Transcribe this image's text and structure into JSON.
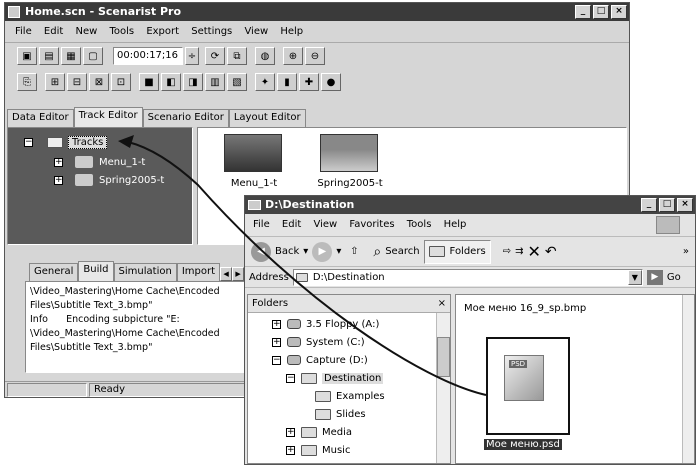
{
  "sp": {
    "title": "Home.scn - Scenarist Pro",
    "menu": [
      "File",
      "Edit",
      "New",
      "Tools",
      "Export",
      "Settings",
      "View",
      "Help"
    ],
    "timecode": "00:00:17;16",
    "tabs": [
      "Data Editor",
      "Track Editor",
      "Scenario Editor",
      "Layout Editor"
    ],
    "tree": {
      "root": "Tracks",
      "items": [
        "Menu_1-t",
        "Spring2005-t"
      ]
    },
    "thumbs": [
      "Menu_1-t",
      "Spring2005-t"
    ],
    "log_tabs": [
      "General",
      "Build",
      "Simulation",
      "Import"
    ],
    "log_lines": [
      "\\Video_Mastering\\Home Cache\\Encoded",
      "Files\\Subtitle Text_3.bmp\"",
      "Info      Encoding subpicture \"E:",
      "\\Video_Mastering\\Home Cache\\Encoded",
      "Files\\Subtitle Text_3.bmp\""
    ],
    "status": "Ready"
  },
  "ex": {
    "title": "D:\\Destination",
    "menu": [
      "File",
      "Edit",
      "View",
      "Favorites",
      "Tools",
      "Help"
    ],
    "back": "Back",
    "search": "Search",
    "folders": "Folders",
    "address_label": "Address",
    "address": "D:\\Destination",
    "go": "Go",
    "folders_title": "Folders",
    "tree": [
      {
        "label": "3.5 Floppy (A:)",
        "lvl": 1,
        "pm": "+",
        "icon": "drive"
      },
      {
        "label": "System (C:)",
        "lvl": 1,
        "pm": "+",
        "icon": "drive"
      },
      {
        "label": "Capture (D:)",
        "lvl": 1,
        "pm": "−",
        "icon": "drive"
      },
      {
        "label": "Destination",
        "lvl": 2,
        "pm": "−",
        "icon": "folder",
        "sel": true
      },
      {
        "label": "Examples",
        "lvl": 3,
        "pm": "",
        "icon": "folder"
      },
      {
        "label": "Slides",
        "lvl": 3,
        "pm": "",
        "icon": "folder"
      },
      {
        "label": "Media",
        "lvl": 2,
        "pm": "+",
        "icon": "folder"
      },
      {
        "label": "Music",
        "lvl": 2,
        "pm": "+",
        "icon": "folder"
      }
    ],
    "file_top": "Мое меню 16_9_sp.bmp",
    "file_psd": "Мое меню.psd",
    "psd_badge": "PSD"
  }
}
